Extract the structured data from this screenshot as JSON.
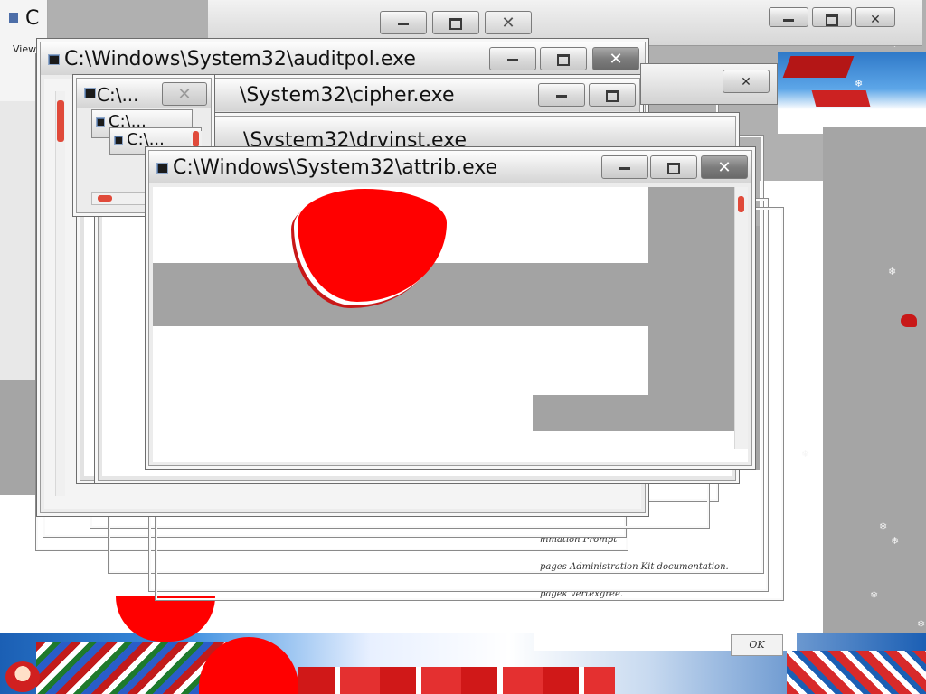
{
  "background": {
    "snowflake_glyph": "❄",
    "accent_red": "#ff0000",
    "top_left_window_fragment": {
      "title_fragment": "C",
      "menu_fragment": "View"
    },
    "doc_fragment": {
      "lines": [
        "mmation Prompt",
        "pages Administration Kit documentation.",
        "pagek vertexgree."
      ],
      "button_fragment": "OK"
    }
  },
  "windows": [
    {
      "id": "auditpol",
      "title": "C:\\Windows\\System32\\auditpol.exe",
      "buttons": {
        "minimize": "minimize",
        "maximize": "maximize",
        "close": "✕"
      }
    },
    {
      "id": "cipher",
      "title": "C:\\...",
      "title_tail": "\\System32\\cipher.exe",
      "buttons": {
        "minimize": "minimize",
        "maximize": "maximize",
        "close": "✕"
      }
    },
    {
      "id": "drvinst",
      "title_tail": "\\System32\\drvinst.exe",
      "small_titles": [
        "C:\\...",
        "C:\\..."
      ]
    },
    {
      "id": "attrib",
      "title": "C:\\Windows\\System32\\attrib.exe",
      "buttons": {
        "minimize": "minimize",
        "maximize": "maximize",
        "close": "✕"
      }
    }
  ]
}
